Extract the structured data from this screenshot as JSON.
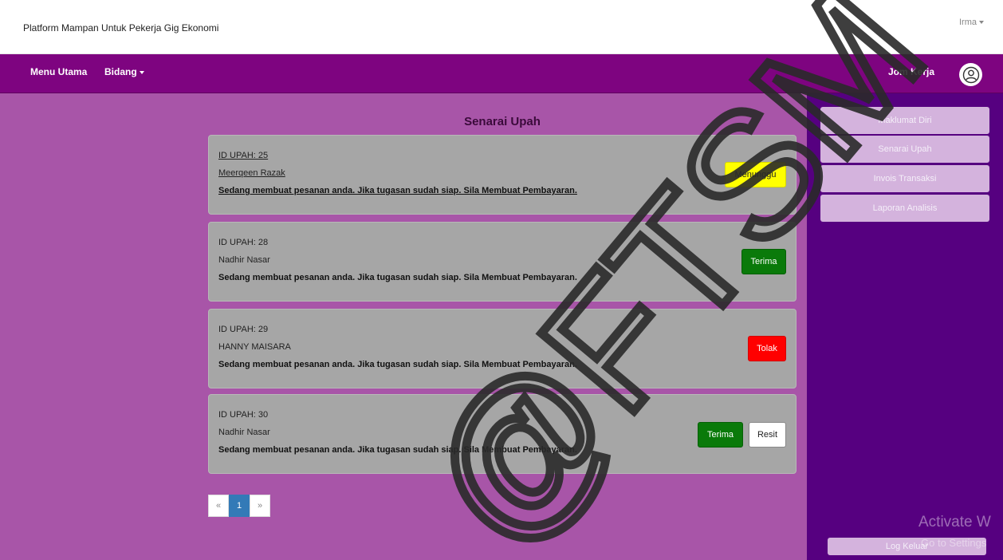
{
  "header": {
    "brand": "Platform Mampan Untuk Pekerja Gig Ekonomi",
    "user": "Irma"
  },
  "nav": {
    "menu_utama": "Menu Utama",
    "bidang": "Bidang",
    "jom_kerja": "Jom Kerja",
    "avatar_icon": "user-circle-icon"
  },
  "page": {
    "title": "Senarai Upah"
  },
  "cards": [
    {
      "id": "ID UPAH: 25",
      "name": "Meerqeen Razak",
      "message": "Sedang membuat pesanan anda. Jika tugasan sudah siap. Sila Membuat Pembayaran.",
      "status": "Menunggu",
      "status_color": "#ffff00"
    },
    {
      "id": "ID UPAH: 28",
      "name": "Nadhir Nasar",
      "message": "Sedang membuat pesanan anda. Jika tugasan sudah siap. Sila Membuat Pembayaran.",
      "status": "Terima",
      "status_color": "#0a7a0a"
    },
    {
      "id": "ID UPAH: 29",
      "name": "HANNY MAISARA",
      "message": "Sedang membuat pesanan anda. Jika tugasan sudah siap. Sila Membuat Pembayaran.",
      "status": "Tolak",
      "status_color": "#ff0000"
    },
    {
      "id": "ID UPAH: 30",
      "name": "Nadhir Nasar",
      "message": "Sedang membuat pesanan anda. Jika tugasan sudah siap. Sila Membuat Pembayaran.",
      "status": "Terima",
      "status_color": "#0a7a0a",
      "extra_button": "Resit"
    }
  ],
  "pagination": {
    "prev": "«",
    "current": "1",
    "next": "»"
  },
  "sidebar": {
    "items": [
      {
        "label": "Maklumat Diri"
      },
      {
        "label": "Senarai Upah"
      },
      {
        "label": "Invois Transaksi"
      },
      {
        "label": "Laporan Analisis"
      }
    ],
    "logout": "Log Keluar"
  },
  "overlay": {
    "activate_line1": "Activate W",
    "activate_line2": "Go to Settings",
    "watermark": "@FTSM"
  },
  "colors": {
    "navbar": "#7e0480",
    "content_bg": "#a855a8",
    "sidebar_bg": "#560080",
    "card_bg": "#a6a6a6",
    "sidebar_button": "#d4b3dd",
    "pager_active": "#337ab7"
  }
}
